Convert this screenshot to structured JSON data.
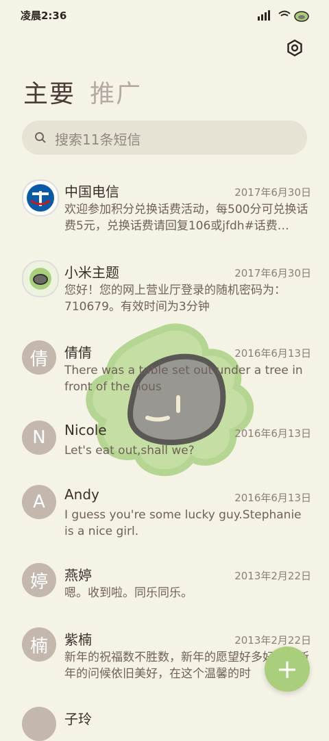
{
  "status_bar": {
    "time": "凌晨2:36"
  },
  "header": {
    "tabs": [
      {
        "label": "主要",
        "active": true
      },
      {
        "label": "推广",
        "active": false
      }
    ]
  },
  "search": {
    "placeholder": "搜索11条短信"
  },
  "messages": [
    {
      "name": "中国电信",
      "date": "2017年6月30日",
      "preview": "欢迎参加积分兑换话费活动，每500分可兑换话费5元，兑换话费请回复106或jfdh#话费…",
      "avatar": "",
      "avatar_icon": "china-telecom-logo-icon"
    },
    {
      "name": "小米主题",
      "date": "2017年6月30日",
      "preview": "您好！您的网上营业厅登录的随机密码为：710679。有效时间为3分钟",
      "avatar": "",
      "avatar_icon": "xiaomi-theme-logo-icon"
    },
    {
      "name": "倩倩",
      "date": "2016年6月13日",
      "preview": "There was a table set out under a tree in front of the hous",
      "avatar": "倩"
    },
    {
      "name": "Nicole",
      "date": "2016年6月13日",
      "preview": "Let's eat out,shall we?",
      "avatar": "N"
    },
    {
      "name": "Andy",
      "date": "2016年6月13日",
      "preview": "I guess you're some lucky guy.Stephanie is a nice girl.",
      "avatar": "A"
    },
    {
      "name": "燕婷",
      "date": "2013年2月22日",
      "preview": "嗯。收到啦。同乐同乐。",
      "avatar": "婷"
    },
    {
      "name": "紫楠",
      "date": "2013年2月22日",
      "preview": "新年的祝福数不胜数，新年的愿望好多好多，新年的问候依旧美好，在这个温馨的时",
      "avatar": "楠"
    },
    {
      "name": "子玲",
      "date": "",
      "preview": "",
      "avatar": ""
    }
  ],
  "colors": {
    "background": "#f5f3e6",
    "avatar": "#c3b7ae",
    "fab": "#a9cf7c",
    "deco_green": "#b7d98f"
  },
  "fab": {
    "icon": "plus-icon",
    "label": "+"
  }
}
